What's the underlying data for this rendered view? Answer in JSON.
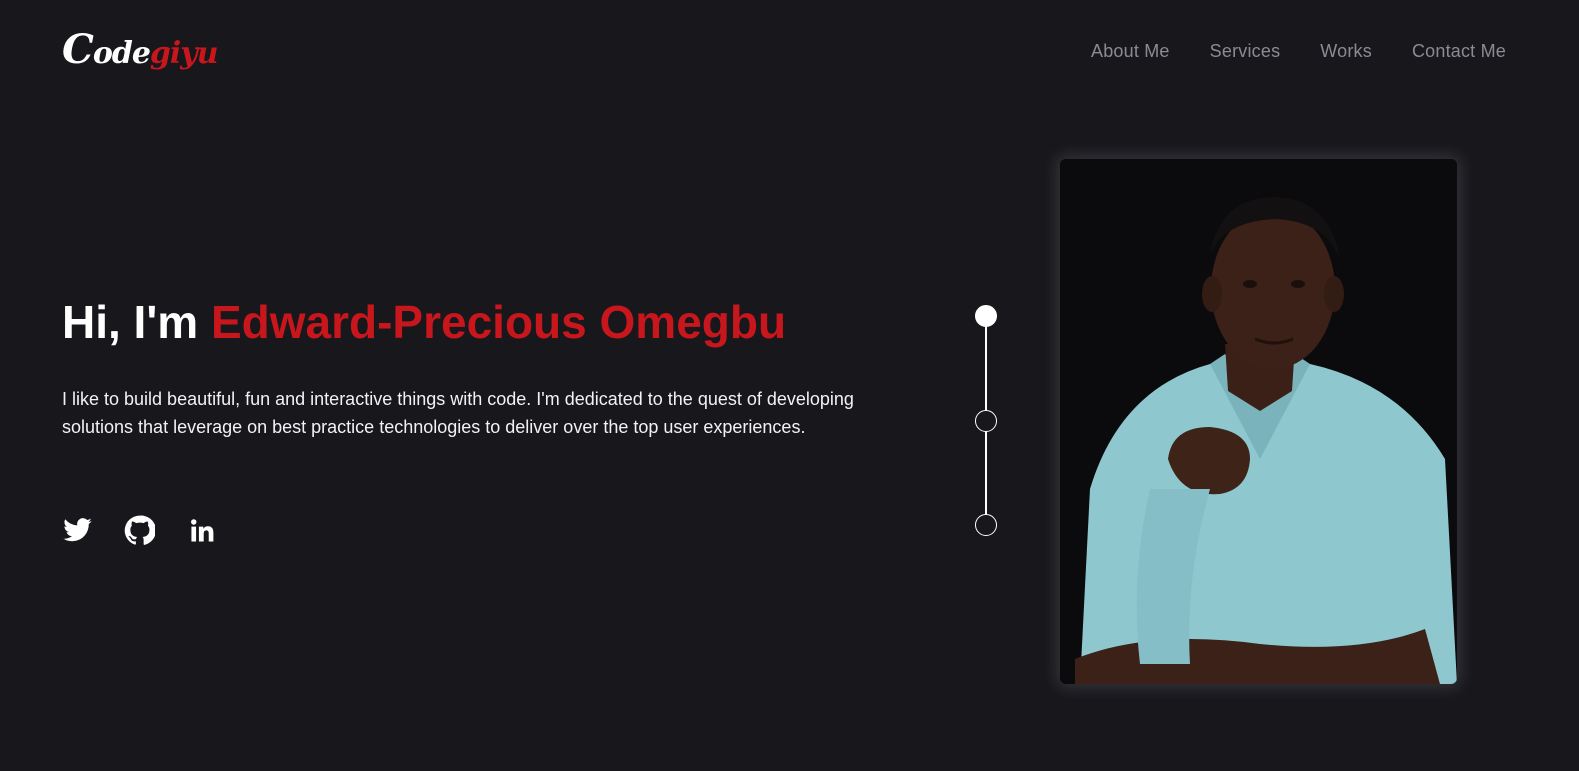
{
  "logo": {
    "first_letter": "C",
    "white_text": "ode",
    "red_text": "giyu"
  },
  "nav": {
    "items": [
      {
        "label": "About Me"
      },
      {
        "label": "Services"
      },
      {
        "label": "Works"
      },
      {
        "label": "Contact Me"
      }
    ]
  },
  "hero": {
    "greeting": "Hi, I'm ",
    "name": "Edward-Precious Omegbu",
    "description": "I like to build beautiful, fun and interactive things with code. I'm dedicated to the quest of developing solutions that leverage on best practice technologies to deliver over the top user experiences."
  },
  "social": {
    "icons": [
      "twitter-icon",
      "github-icon",
      "linkedin-icon"
    ]
  },
  "stepper": {
    "count": 3,
    "active_index": 1
  },
  "colors": {
    "background": "#17171c",
    "accent": "#c8161d",
    "nav_text": "#8b8b93",
    "text": "#ffffff"
  }
}
